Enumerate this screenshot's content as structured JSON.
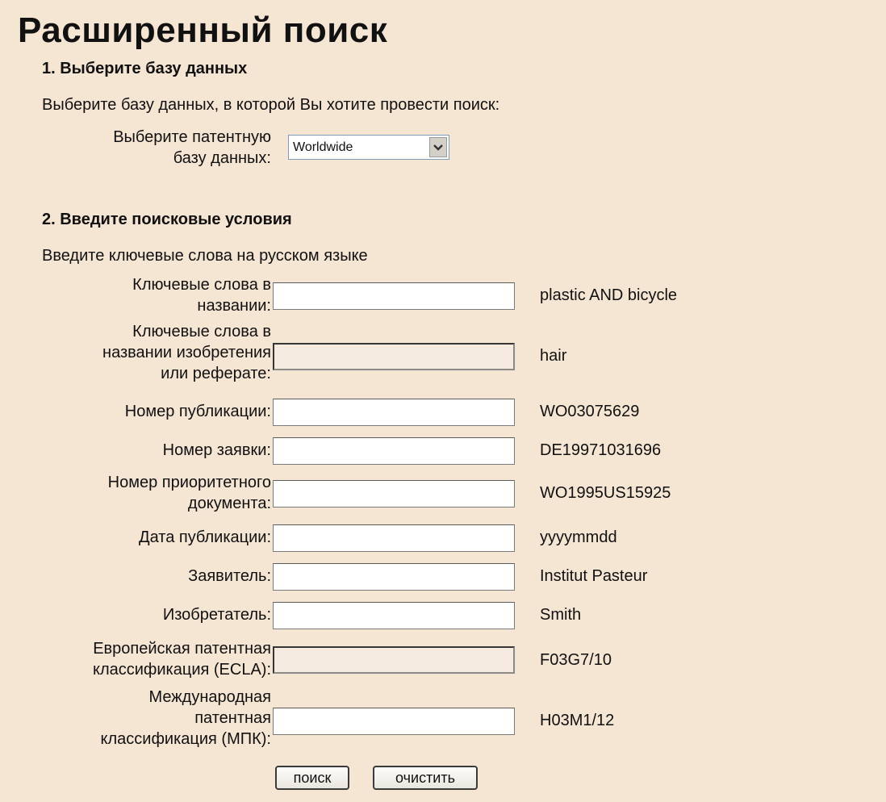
{
  "page": {
    "title": "Расширенный поиск"
  },
  "section1": {
    "heading": "1. Выберите базу данных",
    "instruction": "Выберите базу данных, в которой Вы хотите провести поиск:",
    "db_label_line1": "Выберите патентную",
    "db_label_line2": "базу данных:",
    "db_selected": "Worldwide"
  },
  "section2": {
    "heading": "2. Введите поисковые условия",
    "instruction": "Введите ключевые слова на русском языке",
    "fields": [
      {
        "label_lines": [
          "Ключевые слова в",
          "названии:"
        ],
        "value": "",
        "example": "plastic AND bicycle"
      },
      {
        "label_lines": [
          "Ключевые слова в",
          "названии изобретения",
          "или реферате:"
        ],
        "value": "",
        "example": "hair"
      },
      {
        "label_lines": [
          "Номер публикации:"
        ],
        "value": "",
        "example": "WO03075629"
      },
      {
        "label_lines": [
          "Номер заявки:"
        ],
        "value": "",
        "example": "DE19971031696"
      },
      {
        "label_lines": [
          "Номер приоритетного",
          "документа:"
        ],
        "value": "",
        "example": "WO1995US15925"
      },
      {
        "label_lines": [
          "Дата публикации:"
        ],
        "value": "",
        "example": "yyyymmdd"
      },
      {
        "label_lines": [
          "Заявитель:"
        ],
        "value": "",
        "example": "Institut Pasteur"
      },
      {
        "label_lines": [
          "Изобретатель:"
        ],
        "value": "",
        "example": "Smith"
      },
      {
        "label_lines": [
          "Европейская патентная",
          "классификация (ECLA):"
        ],
        "value": "",
        "example": "F03G7/10"
      },
      {
        "label_lines": [
          "Международная",
          "патентная",
          "классификация (МПК):"
        ],
        "value": "",
        "example": "H03M1/12"
      }
    ]
  },
  "buttons": {
    "search": "поиск",
    "clear": "очистить"
  }
}
